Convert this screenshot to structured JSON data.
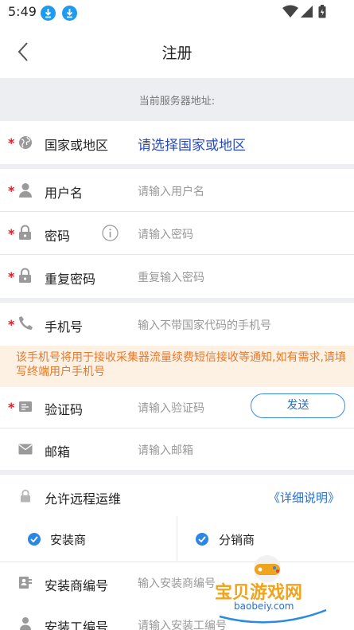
{
  "status_bar": {
    "time": "5:49"
  },
  "header": {
    "title": "注册"
  },
  "server": {
    "label": "当前服务器地址:"
  },
  "form": {
    "country": {
      "label": "国家或地区",
      "value": "请选择国家或地区",
      "value_color": "#2a4bb5"
    },
    "username": {
      "label": "用户名",
      "placeholder": "请输入用户名"
    },
    "password": {
      "label": "密码",
      "placeholder": "请输入密码"
    },
    "password_repeat": {
      "label": "重复密码",
      "placeholder": "重复输入密码"
    },
    "phone": {
      "label": "手机号",
      "placeholder": "输入不带国家代码的手机号"
    },
    "phone_notice": "该手机号将用于接收采集器流量续费短信接收等通知,如有需求,请填写终端用户手机号",
    "code": {
      "label": "验证码",
      "placeholder": "请输入验证码",
      "send_label": "发送"
    },
    "email": {
      "label": "邮箱",
      "placeholder": "请输入邮箱"
    },
    "remote": {
      "label": "允许远程运维",
      "detail_link": "《详细说明》"
    },
    "roles": [
      {
        "label": "安装商",
        "checked": true
      },
      {
        "label": "分销商",
        "checked": true
      }
    ],
    "installer_no": {
      "label": "安装商编号",
      "placeholder": "输入安装商编号"
    },
    "installer_worker_no": {
      "label": "安装工编号",
      "placeholder": "请输入安装工编号"
    }
  },
  "watermark": {
    "brand": "宝贝游戏网",
    "url": "baobeiy.com"
  },
  "colors": {
    "required": "#d8202a",
    "accent": "#2b86e8",
    "notice_text": "#e7792b",
    "notice_bg": "#fdf1e4",
    "section_bg": "#eceef2"
  }
}
